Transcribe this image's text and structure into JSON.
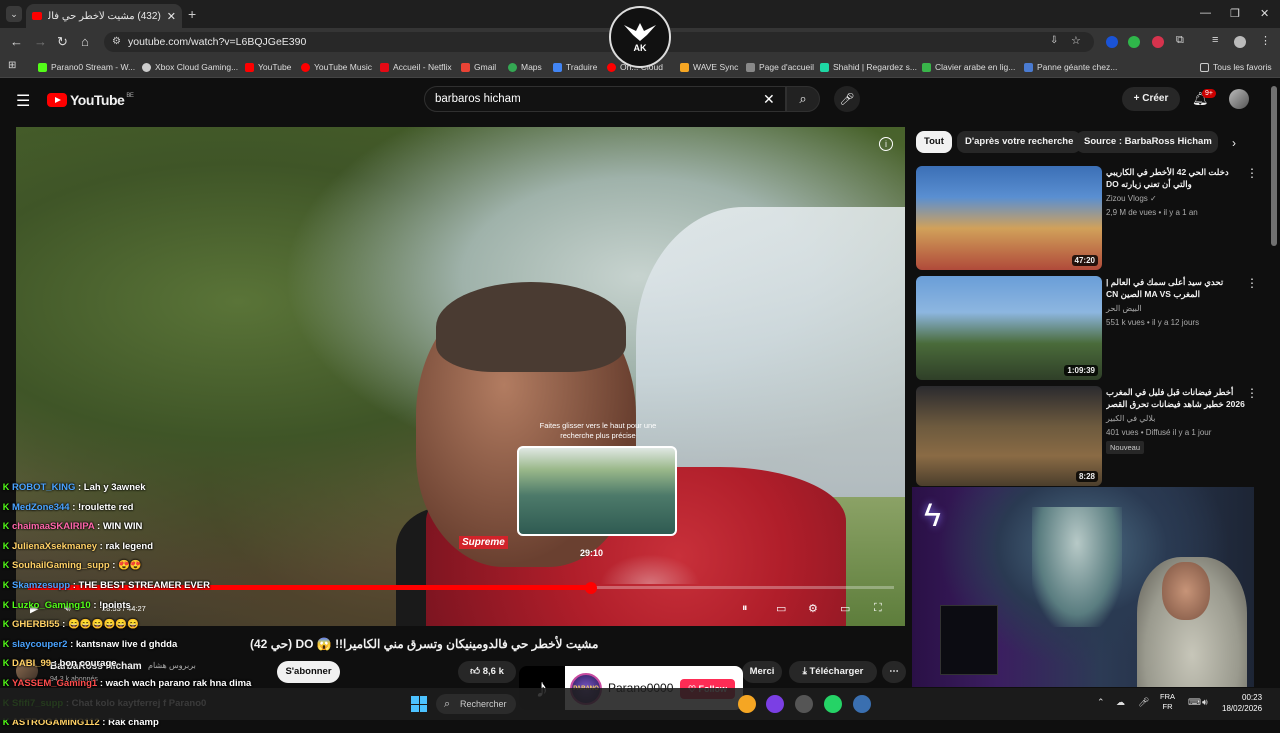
{
  "browser": {
    "tab_title": "(432) مشيت لأخطر حي فالدومي...",
    "url": "youtube.com/watch?v=L6BQJGeE390",
    "bookmarks": [
      {
        "label": "Parano0 Stream - W...",
        "color": "#53fc18"
      },
      {
        "label": "Xbox Cloud Gaming...",
        "color": "#cccccc"
      },
      {
        "label": "YouTube",
        "color": "#ff0000"
      },
      {
        "label": "YouTube Music",
        "color": "#ff0000"
      },
      {
        "label": "Accueil - Netflix",
        "color": "#e50914"
      },
      {
        "label": "Gmail",
        "color": "#ea4335"
      },
      {
        "label": "Maps",
        "color": "#34a853"
      },
      {
        "label": "Traduire",
        "color": "#4285f4"
      },
      {
        "label": "On... Cloud",
        "color": "#ff0000"
      },
      {
        "label": "WAVE Sync",
        "color": "#f5a623"
      },
      {
        "label": "Page d'accueil",
        "color": "#888888"
      },
      {
        "label": "Shahid | Regardez s...",
        "color": "#1ed7a4"
      },
      {
        "label": "Clavier arabe en lig...",
        "color": "#39b54a"
      },
      {
        "label": "Panne géante chez...",
        "color": "#4a7bd1"
      }
    ],
    "all_favorites": "Tous les favoris"
  },
  "youtube": {
    "logo_text": "YouTube",
    "logo_region": "BE",
    "search_value": "barbaros hicham",
    "create_label": "Créer",
    "notif_count": "9+"
  },
  "video": {
    "drag_hint": "Faites glisser vers le haut pour une recherche plus précise",
    "preview_time": "29:10",
    "timecode": "28:53 / 44:27",
    "progress": 0.65,
    "shirt_text": "Supreme"
  },
  "below": {
    "title": "مشيت لأخطر حي فالدومينيكان وتسرق مني الكاميرا!! 😱 DO (حي 42)",
    "channel_name": "BarbaRoss Hicham",
    "channel_ar": "بربروس هشام",
    "subs": "94,3 k abonnés",
    "subscribe": "S'abonner",
    "likes": "8,6 k",
    "thanks": "Merci",
    "download": "Télécharger"
  },
  "chat": [
    {
      "user": "ROBOT_KING",
      "msg": ": Lah y 3awnek",
      "color": "#4aa3ff"
    },
    {
      "user": "MedZone344",
      "msg": ": !roulette red",
      "color": "#4aa3ff"
    },
    {
      "user": "chaimaaSKAIRIPA",
      "msg": ": WIN WIN",
      "color": "#ff66aa"
    },
    {
      "user": "JulienaXsekmaney",
      "msg": ": rak legend",
      "color": "#ffd166"
    },
    {
      "user": "SouhailGaming_supp",
      "msg": ": 😍😍",
      "color": "#ffd166"
    },
    {
      "user": "Skamzesupp",
      "msg": ": THE BEST STREAMER EVER",
      "color": "#4aa3ff"
    },
    {
      "user": "Luzko_Gaming10",
      "msg": ": !points",
      "color": "#53fc18"
    },
    {
      "user": "GHERBI55",
      "msg": ": 😄😄😄😄😄😄",
      "color": "#ffd166"
    },
    {
      "user": "slaycouper2",
      "msg": ": kantsnaw live d ghdda",
      "color": "#4aa3ff"
    },
    {
      "user": "DABI_99",
      "msg": ": bon courage",
      "color": "#ffd166"
    },
    {
      "user": "YASSEM_Gaming1",
      "msg": ": wach wach parano rak hna dima",
      "color": "#ff4d4d"
    },
    {
      "user": "Sfifi7_supp",
      "msg": ": Chat kolo kaytferrej f Parano0",
      "color": "#53fc18"
    },
    {
      "user": "ASTROGAMING112",
      "msg": ": Rak champ",
      "color": "#ffd166"
    }
  ],
  "tiktok": {
    "name": "Parano0000",
    "follow": "Follow",
    "avatar_text": "PARANO"
  },
  "chips": [
    "Tout",
    "D'après votre recherche",
    "Source : BarbaRoss Hicham"
  ],
  "recommendations": [
    {
      "title": "دخلت الحي 42 الأخطر في الكاريبي والتي أن تعني زيارته DO",
      "channel": "Zizou Vlogs",
      "meta": "2,9 M de vues • il y a 1 an",
      "duration": "47:20",
      "verified": "✓"
    },
    {
      "title": "تحدي سيد أعلى سمك في العالم | المغرب MA VS الصين CN",
      "channel": "البيض الحر",
      "meta": "551 k vues • il y a 12 jours",
      "duration": "1:09:39"
    },
    {
      "title": "أخطر فيضانات قبل فليل في المغرب 2026 خطير شاهد فيضانات تحرق القصر الكبير",
      "channel": "بلالي في الكبير",
      "meta": "401 vues • Diffusé il y a 1 jour",
      "duration": "8:28",
      "badge": "Nouveau"
    }
  ],
  "taskbar": {
    "search": "Rechercher",
    "lang_top": "FRA",
    "lang_bottom": "FR",
    "time": "00:23",
    "date": "18/02/2026"
  }
}
